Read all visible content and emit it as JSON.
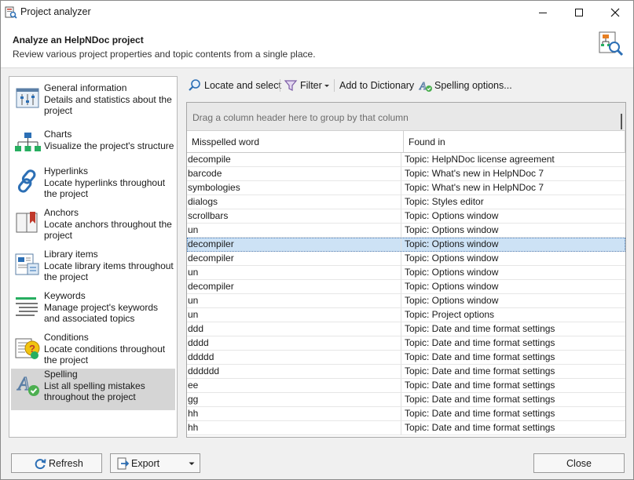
{
  "window": {
    "title": "Project analyzer"
  },
  "header": {
    "title": "Analyze an HelpNDoc project",
    "subtitle": "Review various project properties and topic contents from a single place."
  },
  "nav": {
    "items": [
      {
        "title": "General information",
        "description": "Details and statistics about the project",
        "icon": "sliders-icon"
      },
      {
        "title": "Charts",
        "description": "Visualize the project's structure",
        "icon": "org-chart-icon"
      },
      {
        "title": "Hyperlinks",
        "description": "Locate hyperlinks throughout the project",
        "icon": "chain-link-icon"
      },
      {
        "title": "Anchors",
        "description": "Locate anchors throughout the project",
        "icon": "bookmark-book-icon"
      },
      {
        "title": "Library items",
        "description": "Locate library items throughout the project",
        "icon": "library-document-icon"
      },
      {
        "title": "Keywords",
        "description": "Manage project's keywords and associated topics",
        "icon": "keywords-list-icon"
      },
      {
        "title": "Conditions",
        "description": "Locate conditions throughout the project",
        "icon": "conditions-question-icon"
      },
      {
        "title": "Spelling",
        "description": "List all spelling mistakes throughout the project",
        "icon": "spelling-check-icon"
      }
    ],
    "selected": "Spelling"
  },
  "toolbar": {
    "locate_label": "Locate and select",
    "filter_label": "Filter",
    "add_dict_label": "Add to Dictionary",
    "spelling_options_label": "Spelling options..."
  },
  "grid": {
    "group_hint": "Drag a column header here to group by that column",
    "columns": [
      "Misspelled word",
      "Found in"
    ],
    "rows": [
      [
        "decompile",
        "Topic: HelpNDoc license agreement"
      ],
      [
        "barcode",
        "Topic: What's new in HelpNDoc 7"
      ],
      [
        "symbologies",
        "Topic: What's new in HelpNDoc 7"
      ],
      [
        "dialogs",
        "Topic: Styles editor"
      ],
      [
        "scrollbars",
        "Topic: Options window"
      ],
      [
        "un",
        "Topic: Options window"
      ],
      [
        "decompiler",
        "Topic: Options window"
      ],
      [
        "decompiler",
        "Topic: Options window"
      ],
      [
        "un",
        "Topic: Options window"
      ],
      [
        "decompiler",
        "Topic: Options window"
      ],
      [
        "un",
        "Topic: Options window"
      ],
      [
        "un",
        "Topic: Project options"
      ],
      [
        "ddd",
        "Topic: Date and time format settings"
      ],
      [
        "dddd",
        "Topic: Date and time format settings"
      ],
      [
        "ddddd",
        "Topic: Date and time format settings"
      ],
      [
        "dddddd",
        "Topic: Date and time format settings"
      ],
      [
        "ee",
        "Topic: Date and time format settings"
      ],
      [
        "gg",
        "Topic: Date and time format settings"
      ],
      [
        "hh",
        "Topic: Date and time format settings"
      ],
      [
        "hh",
        "Topic: Date and time format settings"
      ]
    ],
    "selected_row": 6
  },
  "footer": {
    "refresh_label": "Refresh",
    "export_label": "Export",
    "close_label": "Close"
  }
}
